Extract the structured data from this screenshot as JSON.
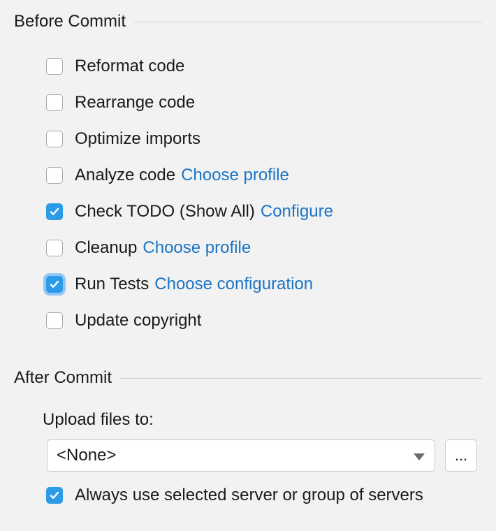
{
  "before_commit": {
    "title": "Before Commit",
    "items": [
      {
        "label": "Reformat code",
        "checked": false
      },
      {
        "label": "Rearrange code",
        "checked": false
      },
      {
        "label": "Optimize imports",
        "checked": false
      },
      {
        "label": "Analyze code",
        "link": "Choose profile",
        "checked": false
      },
      {
        "label": "Check TODO (Show All)",
        "link": "Configure",
        "checked": true
      },
      {
        "label": "Cleanup",
        "link": "Choose profile",
        "checked": false
      },
      {
        "label": "Run Tests",
        "link": "Choose configuration",
        "checked": true,
        "focused": true
      },
      {
        "label": "Update copyright",
        "checked": false
      }
    ]
  },
  "after_commit": {
    "title": "After Commit",
    "upload_label": "Upload files to:",
    "upload_value": "<None>",
    "browse_label": "...",
    "always_use_label": "Always use selected server or group of servers",
    "always_use_checked": true
  },
  "colors": {
    "accent": "#2c9ce8",
    "link": "#1b74c4"
  }
}
